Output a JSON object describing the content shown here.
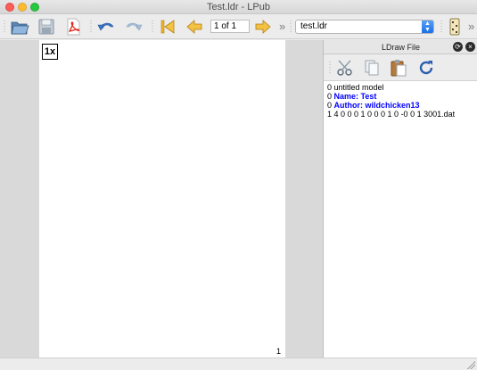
{
  "window": {
    "title": "Test.ldr - LPub"
  },
  "toolbar": {
    "page_field": "1 of 1",
    "file_combo": "test.ldr",
    "icons": [
      "open-icon",
      "save-icon",
      "pdf-icon",
      "undo-icon",
      "redo-icon",
      "first-page-icon",
      "previous-page-icon",
      "next-page-icon",
      "dice-icon"
    ]
  },
  "page": {
    "multiplier": "1x",
    "page_number": "1"
  },
  "dock": {
    "title": "LDraw File",
    "toolbar_icons": [
      "cut-icon",
      "copy-icon",
      "paste-icon",
      "refresh-icon"
    ],
    "lines": [
      {
        "plain": "0 untitled model",
        "kw": ""
      },
      {
        "plain": "0 ",
        "kw": "Name: Test"
      },
      {
        "plain": "0 ",
        "kw": "Author: wildchicken13"
      },
      {
        "plain": "1 4 0 0 0 1 0 0 0 1 0 -0 0 1 3001.dat",
        "kw": ""
      }
    ]
  },
  "colors": {
    "keyword": "#0000ff",
    "accent": "#1a6ee8"
  }
}
